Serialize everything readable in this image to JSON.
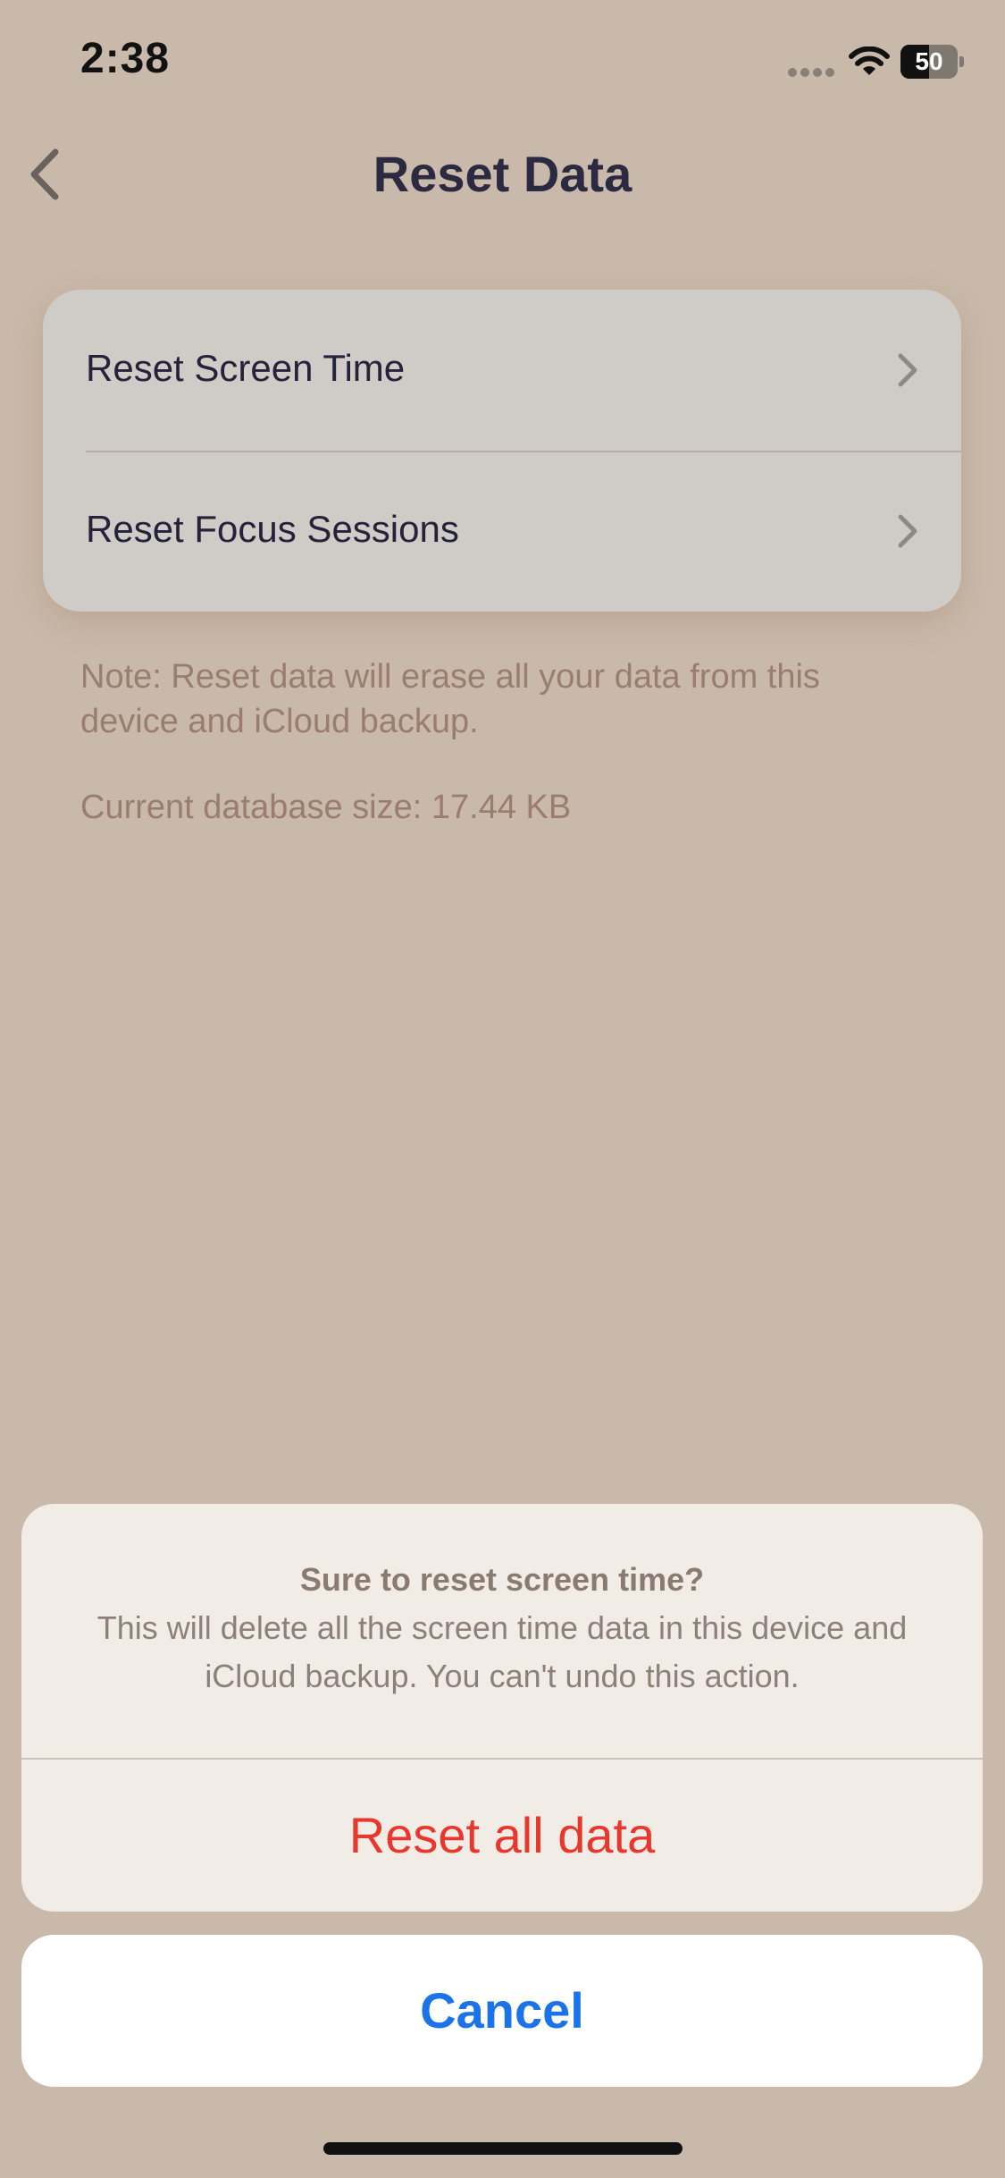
{
  "status_bar": {
    "time": "2:38",
    "battery_level": "50",
    "battery_fraction": 0.5
  },
  "nav": {
    "title": "Reset Data"
  },
  "settings_list": {
    "items": [
      {
        "label": "Reset Screen Time"
      },
      {
        "label": "Reset Focus Sessions"
      }
    ]
  },
  "info": {
    "note": "Note: Reset data will erase all your data from this device and iCloud backup.",
    "db_size": "Current database size: 17.44 KB"
  },
  "action_sheet": {
    "title": "Sure to reset screen time?",
    "message": "This will delete all the screen time data in this device and iCloud backup. You can't undo this action.",
    "destructive_label": "Reset all data",
    "cancel_label": "Cancel"
  },
  "colors": {
    "background": "#c9b9ab",
    "card": "#cfcbc7",
    "sheet": "#f2ece6",
    "destructive": "#e8372d",
    "accent": "#1a73e8",
    "note_text": "#9a7d70"
  },
  "icons": {
    "back": "chevron-left-icon",
    "row_chevron": "chevron-right-icon",
    "wifi": "wifi-icon",
    "battery": "battery-icon",
    "signal": "signal-dots-icon"
  }
}
